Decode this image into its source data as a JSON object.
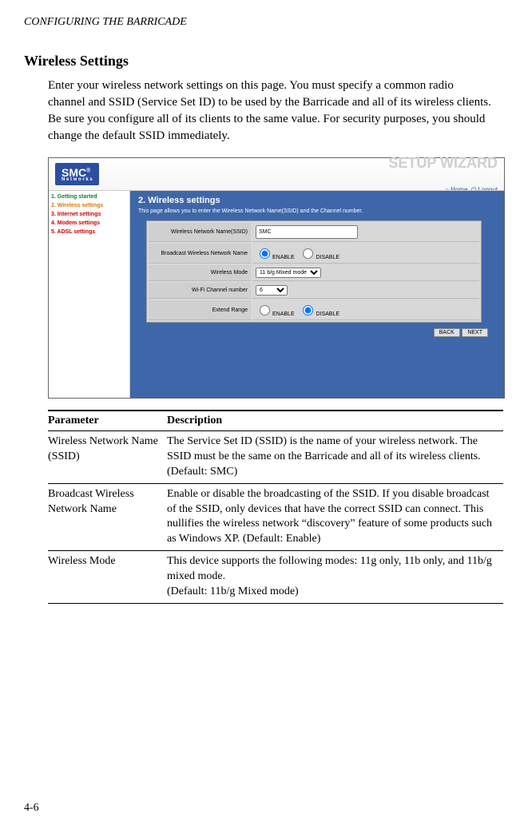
{
  "header": {
    "running": "CONFIGURING THE BARRICADE"
  },
  "section": {
    "title": "Wireless Settings",
    "intro": "Enter your wireless network settings on this page. You must specify a common radio channel and SSID (Service Set ID) to be used by the Barricade and all of its wireless clients. Be sure you configure all of its clients to the same value. For security purposes, you should change the default SSID immediately."
  },
  "screenshot": {
    "logo": "SMC",
    "logo_sub": "N e t w o r k s",
    "wizard": "SETUP WIZARD",
    "home": "Home",
    "logout": "Logout",
    "nav": {
      "i1": "1. Getting started",
      "i2": "2. Wireless settings",
      "i3": "3. Internet settings",
      "i4": "4. Modem settings",
      "i5": "5. ADSL settings"
    },
    "content": {
      "title": "2. Wireless settings",
      "desc": "This page allows you to enter the Wireless Network Name(SSID) and the Channel number.",
      "rows": {
        "ssid_label": "Wireless Network Name(SSID)",
        "ssid_value": "SMC",
        "broadcast_label": "Broadcast Wireless Network Name",
        "enable": "ENABLE",
        "disable": "DISABLE",
        "mode_label": "Wireless Mode",
        "mode_value": "11 b/g Mixed mode",
        "channel_label": "Wi-Fi Channel number",
        "channel_value": "6",
        "extend_label": "Extend Range"
      },
      "back": "BACK",
      "next": "NEXT"
    }
  },
  "table": {
    "h1": "Parameter",
    "h2": "Description",
    "rows": [
      {
        "param": "Wireless Network Name (SSID)",
        "desc": "The Service Set ID (SSID) is the name of your wireless network. The SSID must be the same on the Barricade and all of its wireless clients. (Default: SMC)"
      },
      {
        "param": "Broadcast Wireless Network Name",
        "desc": "Enable or disable the broadcasting of the SSID. If you disable broadcast of the SSID, only devices that have the correct SSID can connect. This nullifies the wireless network “discovery” feature of some products such as Windows XP. (Default: Enable)"
      },
      {
        "param": "Wireless Mode",
        "desc": "This device supports the following modes: 11g only, 11b only, and 11b/g mixed mode.\n(Default: 11b/g Mixed mode)"
      }
    ]
  },
  "page_number": "4-6"
}
